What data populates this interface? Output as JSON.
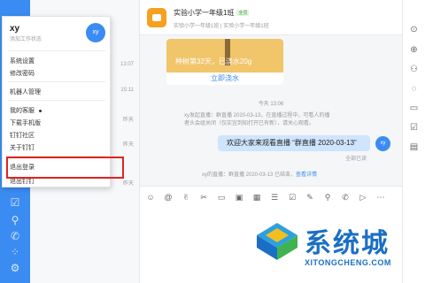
{
  "left_sidebar": {
    "icons": [
      "checkbox-icon",
      "pin-icon",
      "phone-icon",
      "apps-icon",
      "settings-icon"
    ]
  },
  "conversation_list": {
    "add_icon": "+",
    "items": [
      {
        "time": "13:07"
      },
      {
        "time": "15:11"
      },
      {
        "time": "昨天"
      },
      {
        "time": "昨天"
      },
      {
        "time": "昨天"
      }
    ]
  },
  "user_menu": {
    "username": "xy",
    "status_hint": "添加工作状态",
    "avatar_text": "xy",
    "items": [
      {
        "label": "系统设置"
      },
      {
        "label": "修改密码"
      },
      {
        "label": "机器人管理"
      },
      {
        "label": "我的客服"
      },
      {
        "label": "下载手机版"
      },
      {
        "label": "钉钉社区"
      },
      {
        "label": "关于钉钉"
      },
      {
        "label": "退出登录"
      },
      {
        "label": "退出钉钉"
      }
    ]
  },
  "chat": {
    "group_name": "实验小学一年级1班",
    "group_tag": "全员",
    "group_subtitle": "实验小学一年级1班 | 实验小学一年级1班",
    "card_text": "种树第32天，已浇水20g",
    "card_button": "立即浇水",
    "time_label": "今天 13:06",
    "system_message": "xy发起直播：群直播 2020-03-13，在直播过程中，可看人的播者头会组关闭（仅实宜到知打开已有新），请关心观看。",
    "my_message": "欢迎大家来观看直播 “群直播 2020-03-13”",
    "my_avatar": "xy",
    "read_state": "全部已读",
    "live_end_text": "xy的直播：群直播 2020-03-13 已结束，",
    "live_end_link": "查看详情"
  },
  "toolbar": {
    "icons": [
      "emoji-icon",
      "at-icon",
      "thumbs-up-icon",
      "scissors-icon",
      "folder-icon",
      "image-icon",
      "calendar-icon",
      "task-icon",
      "checkbox-icon",
      "edit-icon",
      "pin-icon",
      "phone-icon",
      "live-icon",
      "more-icon"
    ]
  },
  "right_sidebar": {
    "icons": [
      "more-options-icon",
      "add-member-icon",
      "group-settings-icon",
      "chat-bubble-icon",
      "folder-icon",
      "todo-icon",
      "projector-icon"
    ]
  },
  "watermark": {
    "title": "系统城",
    "url": "XITONGCHENG.COM"
  },
  "colors": {
    "accent": "#3b8cf2",
    "highlight_box": "#e0231e",
    "bubble": "#cfe4fd",
    "watermark": "#1a6fc4"
  }
}
